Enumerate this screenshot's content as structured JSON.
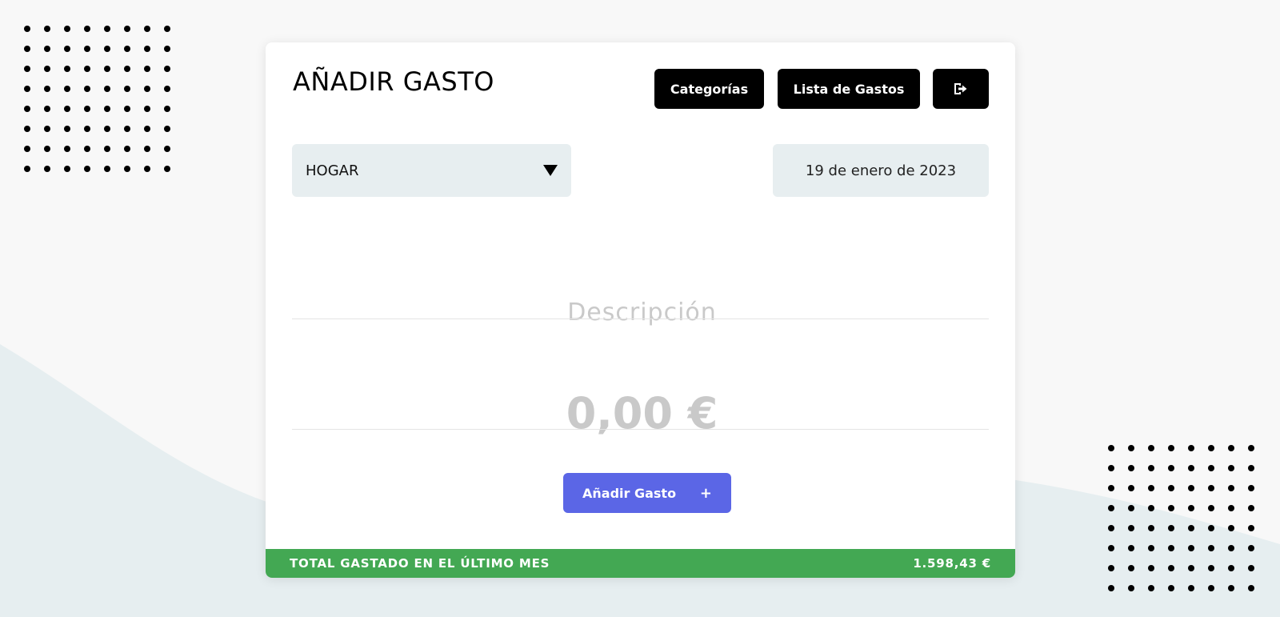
{
  "header": {
    "title": "AÑADIR GASTO",
    "categories_label": "Categorías",
    "expense_list_label": "Lista de Gastos",
    "logout_icon": "logout-icon"
  },
  "form": {
    "category_selected": "HOGAR",
    "date": "19 de enero de 2023",
    "description_placeholder": "Descripción",
    "amount_placeholder": "0,00 €",
    "submit_label": "Añadir Gasto",
    "submit_icon": "+"
  },
  "footer": {
    "total_label": "TOTAL GASTADO EN EL ÚLTIMO MES",
    "total_value": "1.598,43 €"
  },
  "colors": {
    "primary_button": "#5b66e6",
    "footer_green": "#43a853",
    "nav_button": "#000000",
    "field_bg": "#e7eef0"
  }
}
